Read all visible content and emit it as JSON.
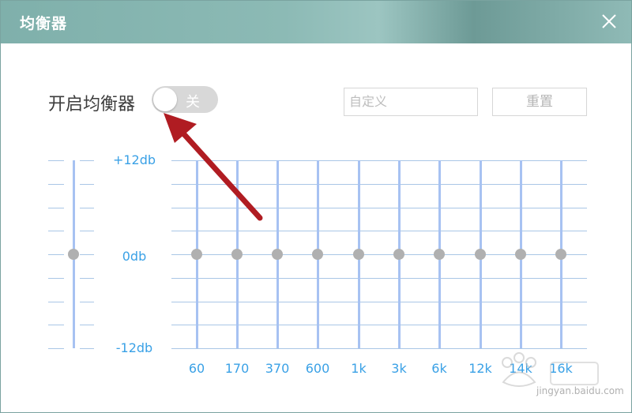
{
  "window": {
    "title": "均衡器"
  },
  "equalizer": {
    "label": "开启均衡器",
    "toggle_state": "关",
    "enabled": false,
    "preset_placeholder": "自定义",
    "reset_label": "重置"
  },
  "scale": {
    "max_label": "+12db",
    "mid_label": "0db",
    "min_label": "-12db"
  },
  "preamp": {
    "value_db": 0
  },
  "bands": [
    {
      "label": "60",
      "value_db": 0
    },
    {
      "label": "170",
      "value_db": 0
    },
    {
      "label": "370",
      "value_db": 0
    },
    {
      "label": "600",
      "value_db": 0
    },
    {
      "label": "1k",
      "value_db": 0
    },
    {
      "label": "3k",
      "value_db": 0
    },
    {
      "label": "6k",
      "value_db": 0
    },
    {
      "label": "12k",
      "value_db": 0
    },
    {
      "label": "14k",
      "value_db": 0
    },
    {
      "label": "16k",
      "value_db": 0
    }
  ],
  "watermark": {
    "text": "jingyan.baidu.com"
  },
  "colors": {
    "accent": "#3aa1e6",
    "track": "#a7c2f2",
    "annotation_arrow": "#b01c22"
  }
}
